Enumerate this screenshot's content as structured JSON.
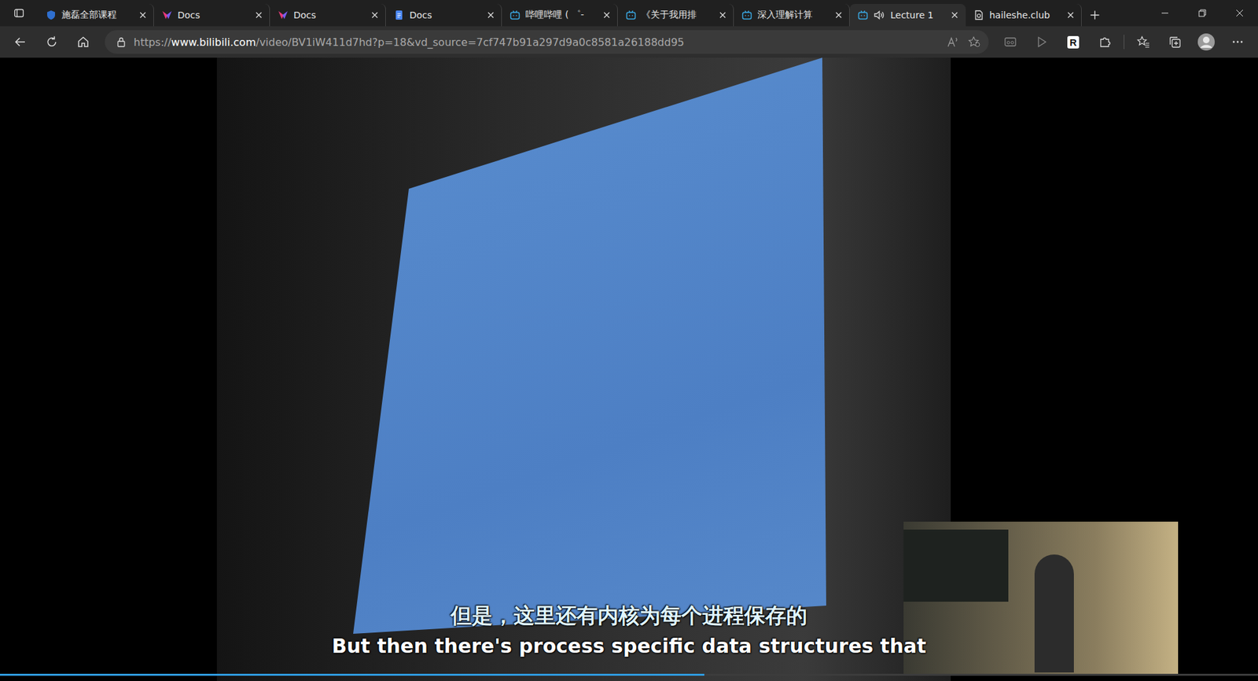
{
  "window": {
    "title": "Lecture 1"
  },
  "tabs": [
    {
      "label": "施磊全部课程",
      "kind": "shield",
      "selected": false,
      "audio": false
    },
    {
      "label": "Docs",
      "kind": "vdocs",
      "selected": false,
      "audio": false
    },
    {
      "label": "Docs",
      "kind": "vdocs",
      "selected": false,
      "audio": false
    },
    {
      "label": "Docs",
      "kind": "gdocs",
      "selected": false,
      "audio": false
    },
    {
      "label": "哔哩哔哩 ( ゜-",
      "kind": "bilibili",
      "selected": false,
      "audio": false
    },
    {
      "label": "《关于我用排",
      "kind": "bilibili",
      "selected": false,
      "audio": false
    },
    {
      "label": "深入理解计算",
      "kind": "bilibili",
      "selected": false,
      "audio": false
    },
    {
      "label": "Lecture 1",
      "kind": "bilibili",
      "selected": true,
      "audio": true
    },
    {
      "label": "haileshe.club",
      "kind": "page",
      "selected": false,
      "audio": false
    }
  ],
  "address": {
    "scheme": "https://",
    "host": "www.bilibili.com",
    "path": "/video/BV1iW411d7hd?p=18&vd_source=7cf747b91a297d9a0c8581a26188dd95"
  },
  "extension_badge": "R",
  "video": {
    "subtitles": [
      "但是，这里还有内核为每个进程保存的",
      "But then there's process specific data structures that"
    ],
    "progress": {
      "level": 0.56
    }
  }
}
